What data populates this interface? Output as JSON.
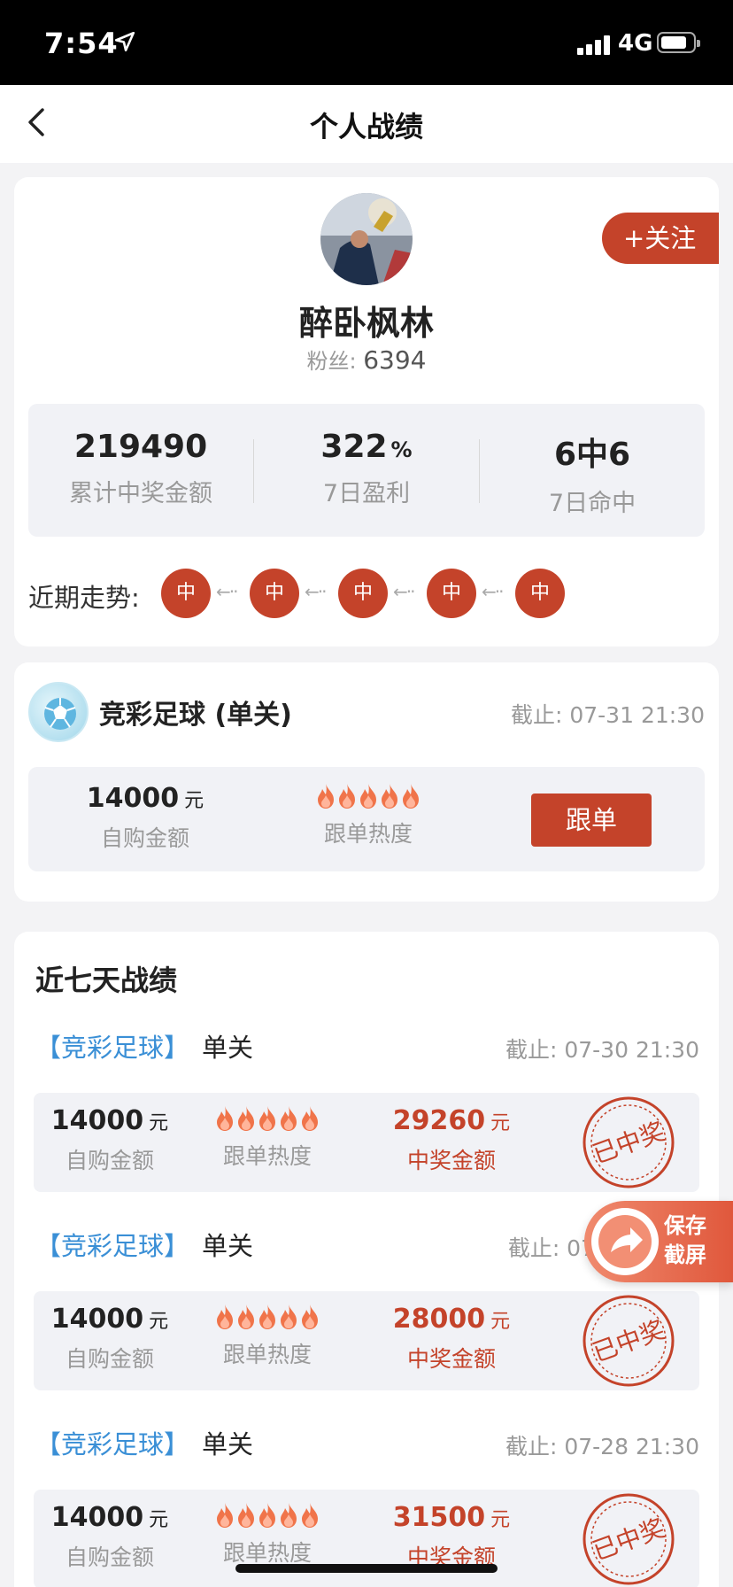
{
  "status_bar": {
    "time": "7:54",
    "network": "4G"
  },
  "nav": {
    "title": "个人战绩"
  },
  "profile": {
    "name": "醉卧枫林",
    "fans_label": "粉丝:",
    "fans_count": "6394",
    "follow_label": "+关注",
    "stats": [
      {
        "value": "219490",
        "unit": "",
        "label": "累计中奖金额"
      },
      {
        "value": "322",
        "unit": "%",
        "label": "7日盈利"
      },
      {
        "value": "6中6",
        "unit": "",
        "label": "7日命中"
      }
    ],
    "trend_label": "近期走势:",
    "trend": [
      "中",
      "中",
      "中",
      "中",
      "中"
    ]
  },
  "current_bet": {
    "title": "竞彩足球 (单关)",
    "deadline": "截止: 07-31 21:30",
    "amount": "14000",
    "unit": "元",
    "amount_label": "自购金额",
    "heat_label": "跟单热度",
    "heat_level": 5,
    "follow_button": "跟单"
  },
  "history": {
    "title": "近七天战绩",
    "records": [
      {
        "tag": "【竞彩足球】",
        "type": "单关",
        "deadline": "截止: 07-30 21:30",
        "amount": "14000",
        "unit": "元",
        "amount_label": "自购金额",
        "heat_label": "跟单热度",
        "prize": "29260",
        "prize_unit": "元",
        "prize_label": "中奖金额",
        "stamp": "已中奖"
      },
      {
        "tag": "【竞彩足球】",
        "type": "单关",
        "deadline": "截止: 07",
        "amount": "14000",
        "unit": "元",
        "amount_label": "自购金额",
        "heat_label": "跟单热度",
        "prize": "28000",
        "prize_unit": "元",
        "prize_label": "中奖金额",
        "stamp": "已中奖"
      },
      {
        "tag": "【竞彩足球】",
        "type": "单关",
        "deadline": "截止: 07-28 21:30",
        "amount": "14000",
        "unit": "元",
        "amount_label": "自购金额",
        "heat_label": "跟单热度",
        "prize": "31500",
        "prize_unit": "元",
        "prize_label": "中奖金额",
        "stamp": "已中奖"
      }
    ]
  },
  "floating": {
    "save_line1": "保存",
    "save_line2": "截屏"
  },
  "colors": {
    "accent": "#c4432a",
    "tag_blue": "#3a8fd6",
    "panel_bg": "#f1f2f6"
  }
}
